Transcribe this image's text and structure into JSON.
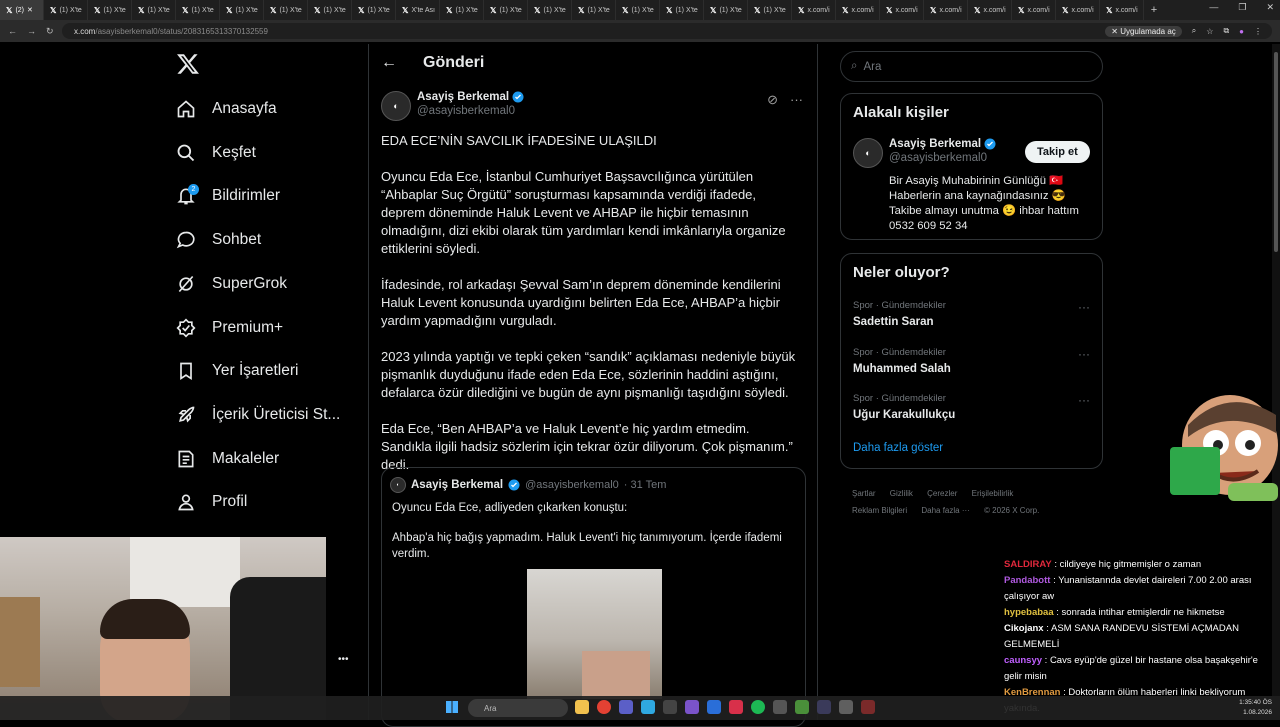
{
  "browser": {
    "tabs": [
      "(2)",
      "(1) X'te",
      "(1) X'te",
      "(1) X'te",
      "(1) X'te",
      "(1) X'te",
      "(1) X'te",
      "(1) X'te",
      "(1) X'te",
      "X'te Ası",
      "(1) X'te",
      "(1) X'te",
      "(1) X'te",
      "(1) X'te",
      "(1) X'te",
      "(1) X'te",
      "(1) X'te",
      "(1) X'te",
      "x.com/i",
      "x.com/i",
      "x.com/i",
      "x.com/i",
      "x.com/i",
      "x.com/i",
      "x.com/i",
      "x.com/i",
      "x.com/i"
    ],
    "url_host": "x.com",
    "url_path": "/asayisberkemal0/status/2083165313370132559",
    "install_label": "Uygulamada aç"
  },
  "sidebar": {
    "items": [
      {
        "label": "Anasayfa",
        "icon": "home-icon"
      },
      {
        "label": "Keşfet",
        "icon": "search-icon"
      },
      {
        "label": "Bildirimler",
        "icon": "bell-icon",
        "badge": "2"
      },
      {
        "label": "Sohbet",
        "icon": "chat-icon"
      },
      {
        "label": "SuperGrok",
        "icon": "grok-icon"
      },
      {
        "label": "Premium+",
        "icon": "premium-icon"
      },
      {
        "label": "Yer İşaretleri",
        "icon": "bookmark-icon"
      },
      {
        "label": "İçerik Üreticisi St...",
        "icon": "rocket-icon"
      },
      {
        "label": "Makaleler",
        "icon": "articles-icon"
      },
      {
        "label": "Profil",
        "icon": "profile-icon"
      }
    ],
    "more_label": "•••"
  },
  "post": {
    "header_title": "Gönderi",
    "author_name": "Asayiş Berkemal",
    "author_handle": "@asayisberkemal0",
    "paragraphs": [
      "EDA ECE’NİN SAVCILIK İFADESİNE ULAŞILDI",
      "Oyuncu Eda Ece, İstanbul Cumhuriyet Başsavcılığınca yürütülen “Ahbaplar Suç Örgütü” soruşturması kapsamında verdiği ifadede, deprem döneminde Haluk Levent ve AHBAP ile hiçbir temasının olmadığını, dizi ekibi olarak tüm yardımları kendi imkânlarıyla organize ettiklerini söyledi.",
      "İfadesinde, rol arkadaşı Şevval Sam’ın deprem döneminde kendilerini Haluk Levent konusunda uyardığını belirten Eda Ece, AHBAP’a hiçbir yardım yapmadığını vurguladı.",
      "2023 yılında yaptığı ve tepki çeken “sandık” açıklaması nedeniyle büyük pişmanlık duyduğunu ifade eden Eda Ece, sözlerinin haddini aştığını, defalarca özür dilediğini ve bugün de aynı pişmanlığı taşıdığını söyledi.",
      "Eda Ece, “Ben AHBAP’a ve Haluk Levent’e hiç yardım etmedim. Sandıkla ilgili hadsiz sözlerim için tekrar özür diliyorum. Çok pişmanım.” dedi."
    ],
    "quote": {
      "author_name": "Asayiş Berkemal",
      "author_handle": "@asayisberkemal0",
      "date": "· 31 Tem",
      "line1": "Oyuncu Eda Ece, adliyeden çıkarken konuştu:",
      "line2": "Ahbap'a hiç bağış yapmadım. Haluk Levent'i hiç tanımıyorum. İçerde ifademi verdim."
    }
  },
  "right": {
    "search_placeholder": "Ara",
    "related_title": "Alakalı kişiler",
    "related_person": {
      "name": "Asayiş Berkemal",
      "handle": "@asayisberkemal0",
      "follow_label": "Takip et",
      "bio": "Bir Asayiş Muhabirinin Günlüğü 🇹🇷 Haberlerin ana kaynağındasınız 😎 Takibe almayı unutma 😉 ihbar hattım 0532 609 52 34"
    },
    "trends_title": "Neler oluyor?",
    "trends": [
      {
        "category": "Spor · Gündemdekiler",
        "topic": "Sadettin Saran"
      },
      {
        "category": "Spor · Gündemdekiler",
        "topic": "Muhammed Salah"
      },
      {
        "category": "Spor · Gündemdekiler",
        "topic": "Uğur Karakullukçu"
      }
    ],
    "show_more": "Daha fazla göster",
    "footer": [
      "Şartlar",
      "Gizlilik",
      "Çerezler",
      "Erişilebilirlik",
      "Reklam Bilgileri",
      "Daha fazla ···",
      "© 2026 X Corp."
    ]
  },
  "chat": [
    {
      "user": "SALDIRAY",
      "msg": ": cildiyeye hiç gitmemişler o zaman",
      "cls": "u1"
    },
    {
      "user": "Pandabott",
      "msg": ": Yunanistannda devlet daireleri 7.00 2.00 arası çalışıyor aw",
      "cls": "u2"
    },
    {
      "user": "hypebabaa",
      "msg": ": sonrada intihar etmişlerdir ne hikmetse",
      "cls": "u3"
    },
    {
      "user": "Cikojanx",
      "msg": ": ASM SANA RANDEVU SİSTEMİ AÇMADAN GELMEMELİ",
      "cls": "u4"
    },
    {
      "user": "caunsyy",
      "msg": ": Cavs eyüp'de güzel bir hastane olsa başakşehir'e gelir misin",
      "cls": "u5"
    },
    {
      "user": "KenBrennan",
      "msg": ": Doktorların ölüm haberleri linki bekliyorum yakında.",
      "cls": "u6"
    }
  ],
  "taskbar": {
    "search_label": "Ara",
    "time": "1:35:40 ÖS",
    "date": "1.08.2026"
  }
}
